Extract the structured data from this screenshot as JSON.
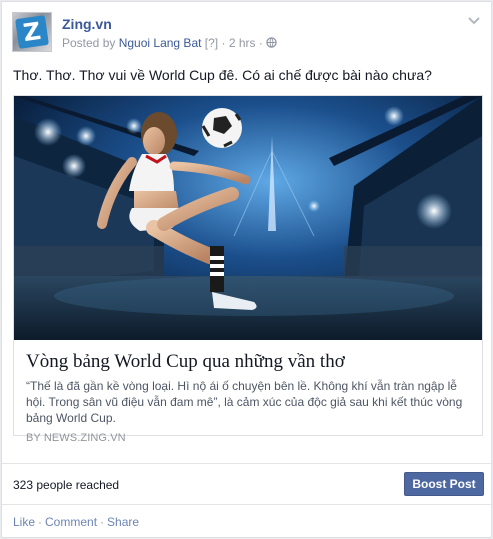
{
  "post": {
    "page_name": "Zing.vn",
    "avatar_letter": "Z",
    "posted_by_prefix": "Posted by",
    "author": "Nguoi Lang Bat",
    "author_tag": "[?]",
    "separator": "·",
    "time": "2 hrs",
    "audience_icon": "globe-icon",
    "status_text": "Thơ. Thơ. Thơ vui về World Cup đê. Có ai chế được bài nào chưa?"
  },
  "link_preview": {
    "title": "Vòng bảng World Cup qua những vần thơ",
    "description": "“Thế là đã gần kề vòng loại. Hì nộ ái ố chuyện bên lề. Không khí vẫn tràn ngập lễ hội. Trong sân vũ điệu vẫn đam mê”, là cảm xúc của độc giả sau khi kết thúc vòng bảng World Cup.",
    "source": "BY NEWS.ZING.VN"
  },
  "footer": {
    "reach": "323 people reached",
    "boost_label": "Boost Post"
  },
  "actions": {
    "like": "Like",
    "comment": "Comment",
    "share": "Share",
    "separator": "·"
  },
  "colors": {
    "link_blue": "#3b5998",
    "boost_bg": "#4e69a2",
    "meta_gray": "#9197a3"
  }
}
